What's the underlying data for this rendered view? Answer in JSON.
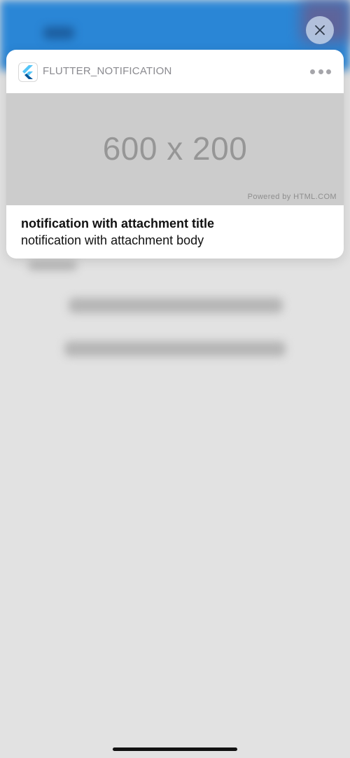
{
  "notification": {
    "app_name": "FLUTTER_NOTIFICATION",
    "app_icon": "flutter-logo-icon",
    "more_icon": "more-dots-icon",
    "attachment": {
      "main_text": "600 x 200",
      "powered_text": "Powered by HTML.COM"
    },
    "title": "notification with attachment title",
    "body": "notification with attachment body"
  },
  "close_button": {
    "icon": "close-icon"
  },
  "colors": {
    "app_bar": "#2a86d6",
    "background": "#e2e2e2",
    "card": "#ffffff",
    "attachment_bg": "#cccccc",
    "flutter_light": "#54c5f8",
    "flutter_dark": "#01579b"
  }
}
